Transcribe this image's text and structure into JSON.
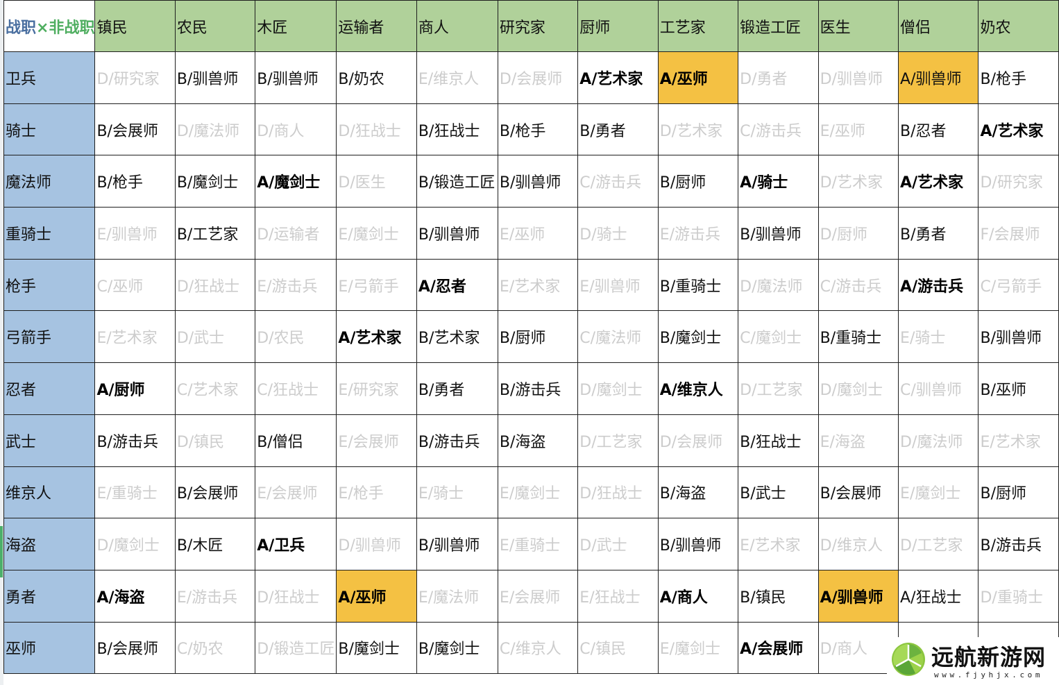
{
  "sheet": {
    "corner_label_part1": "战职",
    "corner_label_part2": "×非战职",
    "columns": [
      "镇民",
      "农民",
      "木匠",
      "运输者",
      "商人",
      "研究家",
      "厨师",
      "工艺家",
      "锻造工匠",
      "医生",
      "僧侣",
      "奶农"
    ],
    "rows": [
      {
        "label": "卫兵",
        "cells": [
          {
            "text": "D/研究家",
            "style": "dim"
          },
          {
            "text": "B/驯兽师",
            "style": "normal"
          },
          {
            "text": "B/驯兽师",
            "style": "normal"
          },
          {
            "text": "B/奶农",
            "style": "normal"
          },
          {
            "text": "E/维京人",
            "style": "dim"
          },
          {
            "text": "D/会展师",
            "style": "dim"
          },
          {
            "text": "A/艺术家",
            "style": "strong"
          },
          {
            "text": "A/巫师",
            "style": "strong-highlight"
          },
          {
            "text": "D/勇者",
            "style": "dim"
          },
          {
            "text": "D/驯兽师",
            "style": "dim"
          },
          {
            "text": "A/驯兽师",
            "style": "highlight"
          },
          {
            "text": "B/枪手",
            "style": "normal"
          }
        ]
      },
      {
        "label": "骑士",
        "cells": [
          {
            "text": "B/会展师",
            "style": "normal"
          },
          {
            "text": "D/魔法师",
            "style": "dim"
          },
          {
            "text": "D/商人",
            "style": "dim"
          },
          {
            "text": "D/狂战士",
            "style": "dim"
          },
          {
            "text": "B/狂战士",
            "style": "normal"
          },
          {
            "text": "B/枪手",
            "style": "normal"
          },
          {
            "text": "B/勇者",
            "style": "normal"
          },
          {
            "text": "D/艺术家",
            "style": "dim"
          },
          {
            "text": "C/游击兵",
            "style": "dim"
          },
          {
            "text": "E/巫师",
            "style": "dim"
          },
          {
            "text": "B/忍者",
            "style": "normal"
          },
          {
            "text": "A/艺术家",
            "style": "strong"
          }
        ]
      },
      {
        "label": "魔法师",
        "cells": [
          {
            "text": "B/枪手",
            "style": "normal"
          },
          {
            "text": "B/魔剑士",
            "style": "normal"
          },
          {
            "text": "A/魔剑士",
            "style": "strong"
          },
          {
            "text": "D/医生",
            "style": "dim"
          },
          {
            "text": "B/锻造工匠",
            "style": "normal"
          },
          {
            "text": "B/驯兽师",
            "style": "normal"
          },
          {
            "text": "C/游击兵",
            "style": "dim"
          },
          {
            "text": "B/厨师",
            "style": "normal"
          },
          {
            "text": "A/骑士",
            "style": "strong"
          },
          {
            "text": "D/艺术家",
            "style": "dim"
          },
          {
            "text": "A/艺术家",
            "style": "strong"
          },
          {
            "text": "D/研究家",
            "style": "dim"
          }
        ]
      },
      {
        "label": "重骑士",
        "cells": [
          {
            "text": "E/驯兽师",
            "style": "dim"
          },
          {
            "text": "B/工艺家",
            "style": "normal"
          },
          {
            "text": "D/运输者",
            "style": "dim"
          },
          {
            "text": "E/魔剑士",
            "style": "dim"
          },
          {
            "text": "B/驯兽师",
            "style": "normal"
          },
          {
            "text": "E/巫师",
            "style": "dim"
          },
          {
            "text": "D/骑士",
            "style": "dim"
          },
          {
            "text": "E/游击兵",
            "style": "dim"
          },
          {
            "text": "B/驯兽师",
            "style": "normal"
          },
          {
            "text": "D/厨师",
            "style": "dim"
          },
          {
            "text": "B/勇者",
            "style": "normal"
          },
          {
            "text": "F/会展师",
            "style": "dim"
          }
        ]
      },
      {
        "label": "枪手",
        "cells": [
          {
            "text": "C/巫师",
            "style": "dim"
          },
          {
            "text": "D/狂战士",
            "style": "dim"
          },
          {
            "text": "E/游击兵",
            "style": "dim"
          },
          {
            "text": "E/弓箭手",
            "style": "dim"
          },
          {
            "text": "A/忍者",
            "style": "strong"
          },
          {
            "text": "E/艺术家",
            "style": "dim"
          },
          {
            "text": "E/驯兽师",
            "style": "dim"
          },
          {
            "text": "B/重骑士",
            "style": "normal"
          },
          {
            "text": "D/魔法师",
            "style": "dim"
          },
          {
            "text": "C/游击兵",
            "style": "dim"
          },
          {
            "text": "A/游击兵",
            "style": "strong"
          },
          {
            "text": "C/弓箭手",
            "style": "dim"
          }
        ]
      },
      {
        "label": "弓箭手",
        "cells": [
          {
            "text": "E/艺术家",
            "style": "dim"
          },
          {
            "text": "D/武士",
            "style": "dim"
          },
          {
            "text": "D/农民",
            "style": "dim"
          },
          {
            "text": "A/艺术家",
            "style": "strong"
          },
          {
            "text": "B/艺术家",
            "style": "normal"
          },
          {
            "text": "B/厨师",
            "style": "normal"
          },
          {
            "text": "C/魔法师",
            "style": "dim"
          },
          {
            "text": "B/魔剑士",
            "style": "normal"
          },
          {
            "text": "C/魔剑士",
            "style": "dim"
          },
          {
            "text": "B/重骑士",
            "style": "normal"
          },
          {
            "text": "E/骑士",
            "style": "dim"
          },
          {
            "text": "B/驯兽师",
            "style": "normal"
          }
        ]
      },
      {
        "label": "忍者",
        "cells": [
          {
            "text": "A/厨师",
            "style": "strong"
          },
          {
            "text": "C/艺术家",
            "style": "dim"
          },
          {
            "text": "C/狂战士",
            "style": "dim"
          },
          {
            "text": "E/研究家",
            "style": "dim"
          },
          {
            "text": "B/勇者",
            "style": "normal"
          },
          {
            "text": "B/游击兵",
            "style": "normal"
          },
          {
            "text": "D/魔剑士",
            "style": "dim"
          },
          {
            "text": "A/维京人",
            "style": "strong"
          },
          {
            "text": "D/工艺家",
            "style": "dim"
          },
          {
            "text": "D/魔剑士",
            "style": "dim"
          },
          {
            "text": "C/驯兽师",
            "style": "dim"
          },
          {
            "text": "B/巫师",
            "style": "normal"
          }
        ]
      },
      {
        "label": "武士",
        "cells": [
          {
            "text": "B/游击兵",
            "style": "normal"
          },
          {
            "text": "D/镇民",
            "style": "dim"
          },
          {
            "text": "B/僧侣",
            "style": "normal"
          },
          {
            "text": "E/会展师",
            "style": "dim"
          },
          {
            "text": "B/游击兵",
            "style": "normal"
          },
          {
            "text": "B/海盗",
            "style": "normal"
          },
          {
            "text": "D/工艺家",
            "style": "dim"
          },
          {
            "text": "D/会展师",
            "style": "dim"
          },
          {
            "text": "B/狂战士",
            "style": "normal"
          },
          {
            "text": "E/海盗",
            "style": "dim"
          },
          {
            "text": "D/魔法师",
            "style": "dim"
          },
          {
            "text": "E/艺术家",
            "style": "dim"
          }
        ]
      },
      {
        "label": "维京人",
        "cells": [
          {
            "text": "E/重骑士",
            "style": "dim"
          },
          {
            "text": "B/会展师",
            "style": "normal"
          },
          {
            "text": "E/会展师",
            "style": "dim"
          },
          {
            "text": "E/枪手",
            "style": "dim"
          },
          {
            "text": "E/骑士",
            "style": "dim"
          },
          {
            "text": "E/魔剑士",
            "style": "dim"
          },
          {
            "text": "D/狂战士",
            "style": "dim"
          },
          {
            "text": "B/海盗",
            "style": "normal"
          },
          {
            "text": "B/武士",
            "style": "normal"
          },
          {
            "text": "B/会展师",
            "style": "normal"
          },
          {
            "text": "E/魔剑士",
            "style": "dim"
          },
          {
            "text": "B/厨师",
            "style": "normal"
          }
        ]
      },
      {
        "label": "海盗",
        "cells": [
          {
            "text": "D/魔剑士",
            "style": "dim"
          },
          {
            "text": "B/木匠",
            "style": "normal"
          },
          {
            "text": "A/卫兵",
            "style": "strong"
          },
          {
            "text": "D/驯兽师",
            "style": "dim"
          },
          {
            "text": "B/驯兽师",
            "style": "normal"
          },
          {
            "text": "E/重骑士",
            "style": "dim"
          },
          {
            "text": "D/武士",
            "style": "dim"
          },
          {
            "text": "B/驯兽师",
            "style": "normal"
          },
          {
            "text": "E/艺术家",
            "style": "dim"
          },
          {
            "text": "D/维京人",
            "style": "dim"
          },
          {
            "text": "D/工艺家",
            "style": "dim"
          },
          {
            "text": "B/游击兵",
            "style": "normal"
          }
        ]
      },
      {
        "label": "勇者",
        "cells": [
          {
            "text": "A/海盗",
            "style": "strong"
          },
          {
            "text": "E/游击兵",
            "style": "dim"
          },
          {
            "text": "D/狂战士",
            "style": "dim"
          },
          {
            "text": "A/巫师",
            "style": "strong-highlight"
          },
          {
            "text": "E/魔法师",
            "style": "dim"
          },
          {
            "text": "E/会展师",
            "style": "dim"
          },
          {
            "text": "E/狂战士",
            "style": "dim"
          },
          {
            "text": "A/商人",
            "style": "strong"
          },
          {
            "text": "B/镇民",
            "style": "normal"
          },
          {
            "text": "A/驯兽师",
            "style": "strong-highlight"
          },
          {
            "text": "A/狂战士",
            "style": "normal"
          },
          {
            "text": "D/重骑士",
            "style": "dim"
          }
        ]
      },
      {
        "label": "巫师",
        "cells": [
          {
            "text": "B/会展师",
            "style": "normal"
          },
          {
            "text": "C/奶农",
            "style": "dim"
          },
          {
            "text": "D/锻造工匠",
            "style": "dim"
          },
          {
            "text": "B/魔剑士",
            "style": "normal"
          },
          {
            "text": "B/魔剑士",
            "style": "normal"
          },
          {
            "text": "C/维京人",
            "style": "dim"
          },
          {
            "text": "C/镇民",
            "style": "dim"
          },
          {
            "text": "E/魔剑士",
            "style": "dim"
          },
          {
            "text": "A/会展师",
            "style": "strong"
          },
          {
            "text": "D/商人",
            "style": "dim"
          },
          {
            "text": "",
            "style": "normal"
          },
          {
            "text": "",
            "style": "normal"
          }
        ]
      }
    ]
  },
  "colors": {
    "header_green": "#b0d19a",
    "row_header_blue": "#a6c3e1",
    "highlight_yellow": "#f4c143",
    "dim_text": "#cccccc",
    "corner_blue": "#4a6fa0",
    "corner_green": "#4fae60"
  },
  "watermark": {
    "icon": "green-leaf-logo-icon",
    "title": "远航新游网",
    "url": "www.fjyhjx.com"
  }
}
